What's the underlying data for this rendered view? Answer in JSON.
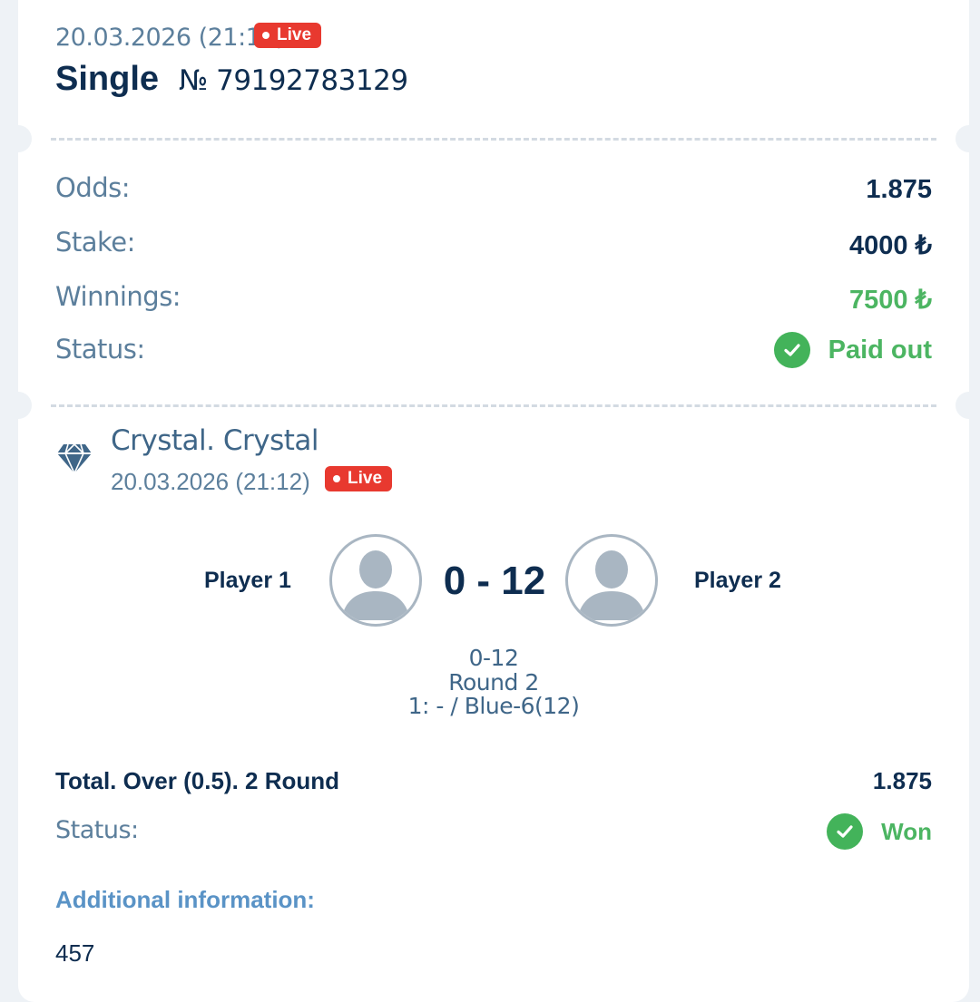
{
  "header": {
    "date": "20.03.2026 (21:11)",
    "live_label": "Live",
    "bet_type": "Single",
    "bet_number": "№ 79192783129"
  },
  "summary": {
    "odds_label": "Odds:",
    "odds_value": "1.875",
    "stake_label": "Stake:",
    "stake_value": "4000 ₺",
    "winnings_label": "Winnings:",
    "winnings_value": "7500 ₺",
    "status_label": "Status:",
    "status_value": "Paid out"
  },
  "event": {
    "icon": "diamond-icon",
    "title": "Crystal. Crystal",
    "date": "20.03.2026 (21:12)",
    "live_label": "Live",
    "player1": "Player 1",
    "player2": "Player 2",
    "score": "0 - 12",
    "details": [
      "0-12",
      "Round 2",
      "1: - / Blue-6(12)"
    ]
  },
  "bet": {
    "name": "Total. Over (0.5). 2 Round",
    "odds": "1.875",
    "status_label": "Status:",
    "status_value": "Won",
    "additional_label": "Additional information:",
    "additional_value": "457"
  },
  "colors": {
    "live": "#e8392f",
    "success": "#43b35a",
    "text_dark": "#0e2d50",
    "text_muted": "#5c7f9c",
    "link": "#5a93c6"
  }
}
